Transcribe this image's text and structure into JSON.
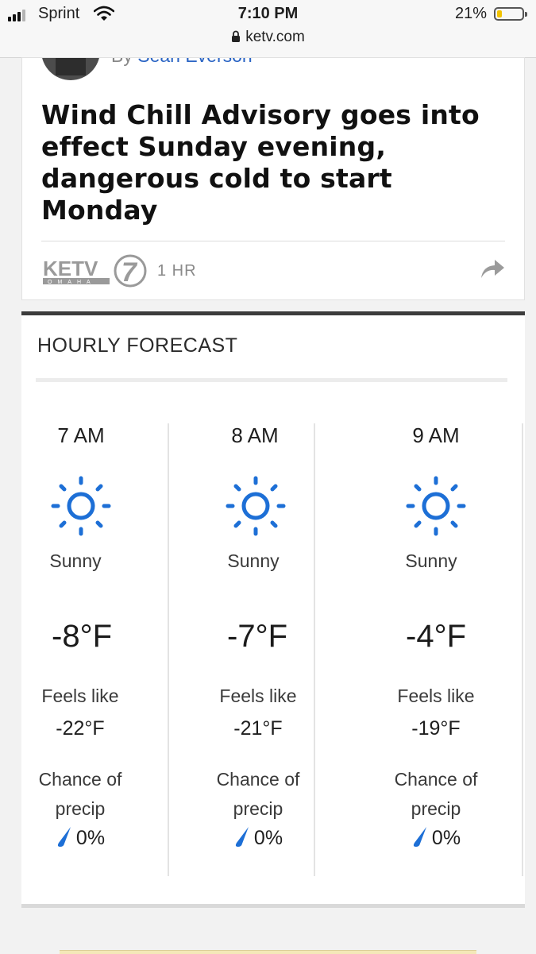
{
  "status_bar": {
    "carrier": "Sprint",
    "time": "7:10 PM",
    "battery_percent": "21%",
    "battery_level": 0.21,
    "url": "ketv.com",
    "icons": [
      "signal-icon",
      "wifi-icon",
      "lock-icon",
      "battery-icon"
    ]
  },
  "article": {
    "byline_prefix": "By",
    "author": "Sean Everson",
    "headline": "Wind Chill Advisory goes into effect Sunday evening, dangerous cold to start Monday",
    "source_logo_text": "KETV",
    "source_logo_number": "7",
    "source_logo_city": "OMAHA",
    "age": "1 HR",
    "share_icon": "share-icon"
  },
  "forecast": {
    "title": "HOURLY FORECAST",
    "feels_like_label": "Feels like",
    "chance_label_line1": "Chance of",
    "chance_label_line2": "precip",
    "hours": [
      {
        "time": "7 AM",
        "icon": "sun-icon",
        "condition": "Sunny",
        "temp": "-8°F",
        "feels_like": "-22°F",
        "precip": "0%"
      },
      {
        "time": "8 AM",
        "icon": "sun-icon",
        "condition": "Sunny",
        "temp": "-7°F",
        "feels_like": "-21°F",
        "precip": "0%"
      },
      {
        "time": "9 AM",
        "icon": "sun-icon",
        "condition": "Sunny",
        "temp": "-4°F",
        "feels_like": "-19°F",
        "precip": "0%"
      }
    ]
  },
  "colors": {
    "accent_blue": "#1d6fd6",
    "author_link": "#2a64c4",
    "forecast_border": "#3c3c3c",
    "battery_low": "#f2c200"
  }
}
